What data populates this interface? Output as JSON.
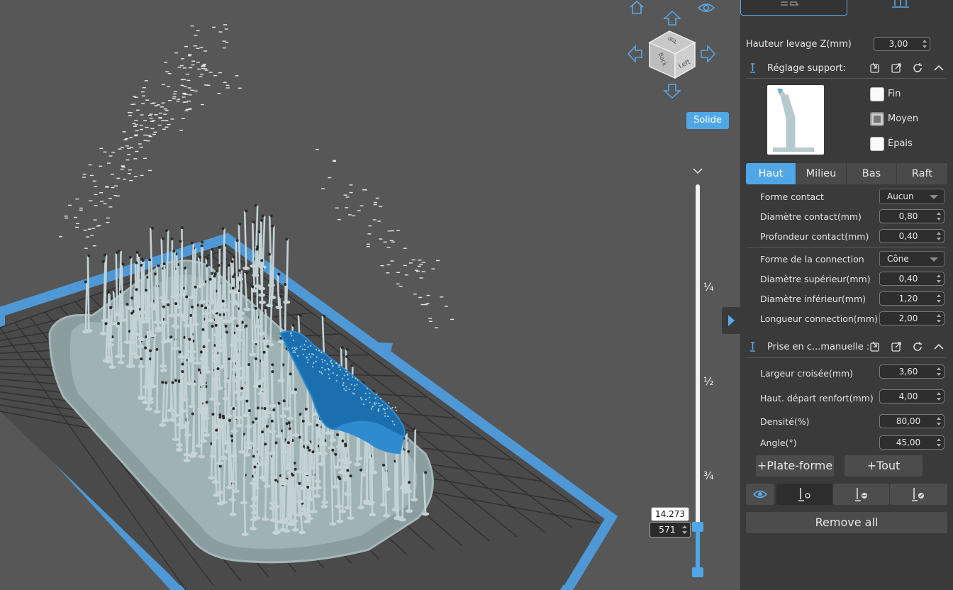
{
  "viewport": {
    "solid_button": "Solide",
    "view_cube": {
      "face_top": "Top",
      "face_back": "Back",
      "face_left": "Left"
    },
    "icons": [
      "home-icon",
      "eye-icon",
      "arrow-up-icon",
      "arrow-down-icon",
      "arrow-left-icon",
      "arrow-right-icon"
    ],
    "slider": {
      "marks": [
        "¼",
        "½",
        "¾"
      ],
      "height_value": "14.273",
      "layer_value": "571"
    }
  },
  "panel": {
    "lift_height": {
      "label": "Hauteur levage Z(mm)",
      "value": "3,00"
    },
    "support_settings": {
      "title": "Réglage support:",
      "density_options": [
        {
          "label": "Fin",
          "checked": false
        },
        {
          "label": "Moyen",
          "checked": true
        },
        {
          "label": "Épais",
          "checked": false
        }
      ],
      "tabs": [
        {
          "label": "Haut",
          "active": true
        },
        {
          "label": "Milieu",
          "active": false
        },
        {
          "label": "Bas",
          "active": false
        },
        {
          "label": "Raft",
          "active": false
        }
      ],
      "contact_shape": {
        "label": "Forme contact",
        "value": "Aucun"
      },
      "contact_diameter": {
        "label": "Diamètre contact(mm)",
        "value": "0,80"
      },
      "contact_depth": {
        "label": "Profondeur contact(mm)",
        "value": "0,40"
      },
      "connection_shape": {
        "label": "Forme de la connection",
        "value": "Cône"
      },
      "upper_diameter": {
        "label": "Diamètre supérieur(mm)",
        "value": "0,40"
      },
      "lower_diameter": {
        "label": "Diamètre inférieur(mm)",
        "value": "1,20"
      },
      "connection_length": {
        "label": "Longueur connection(mm)",
        "value": "2,00"
      }
    },
    "manual_support": {
      "title": "Prise en c...manuelle :",
      "cross_width": {
        "label": "Largeur croisée(mm)",
        "value": "3,60"
      },
      "brace_start": {
        "label": "Haut. départ renfort(mm)",
        "value": "4,00"
      },
      "density": {
        "label": "Densité(%)",
        "value": "80,00"
      },
      "angle": {
        "label": "Angle(°)",
        "value": "45,00"
      },
      "add_platform": "+Plate-forme",
      "add_all": "+Tout"
    },
    "remove_all": "Remove all",
    "colors": {
      "accent": "#4fa7e8",
      "panel_bg": "#3a3a3a",
      "viewport_bg": "#575757",
      "model_blue": "#1c6fae",
      "support_gray": "#b8c7c9"
    }
  }
}
